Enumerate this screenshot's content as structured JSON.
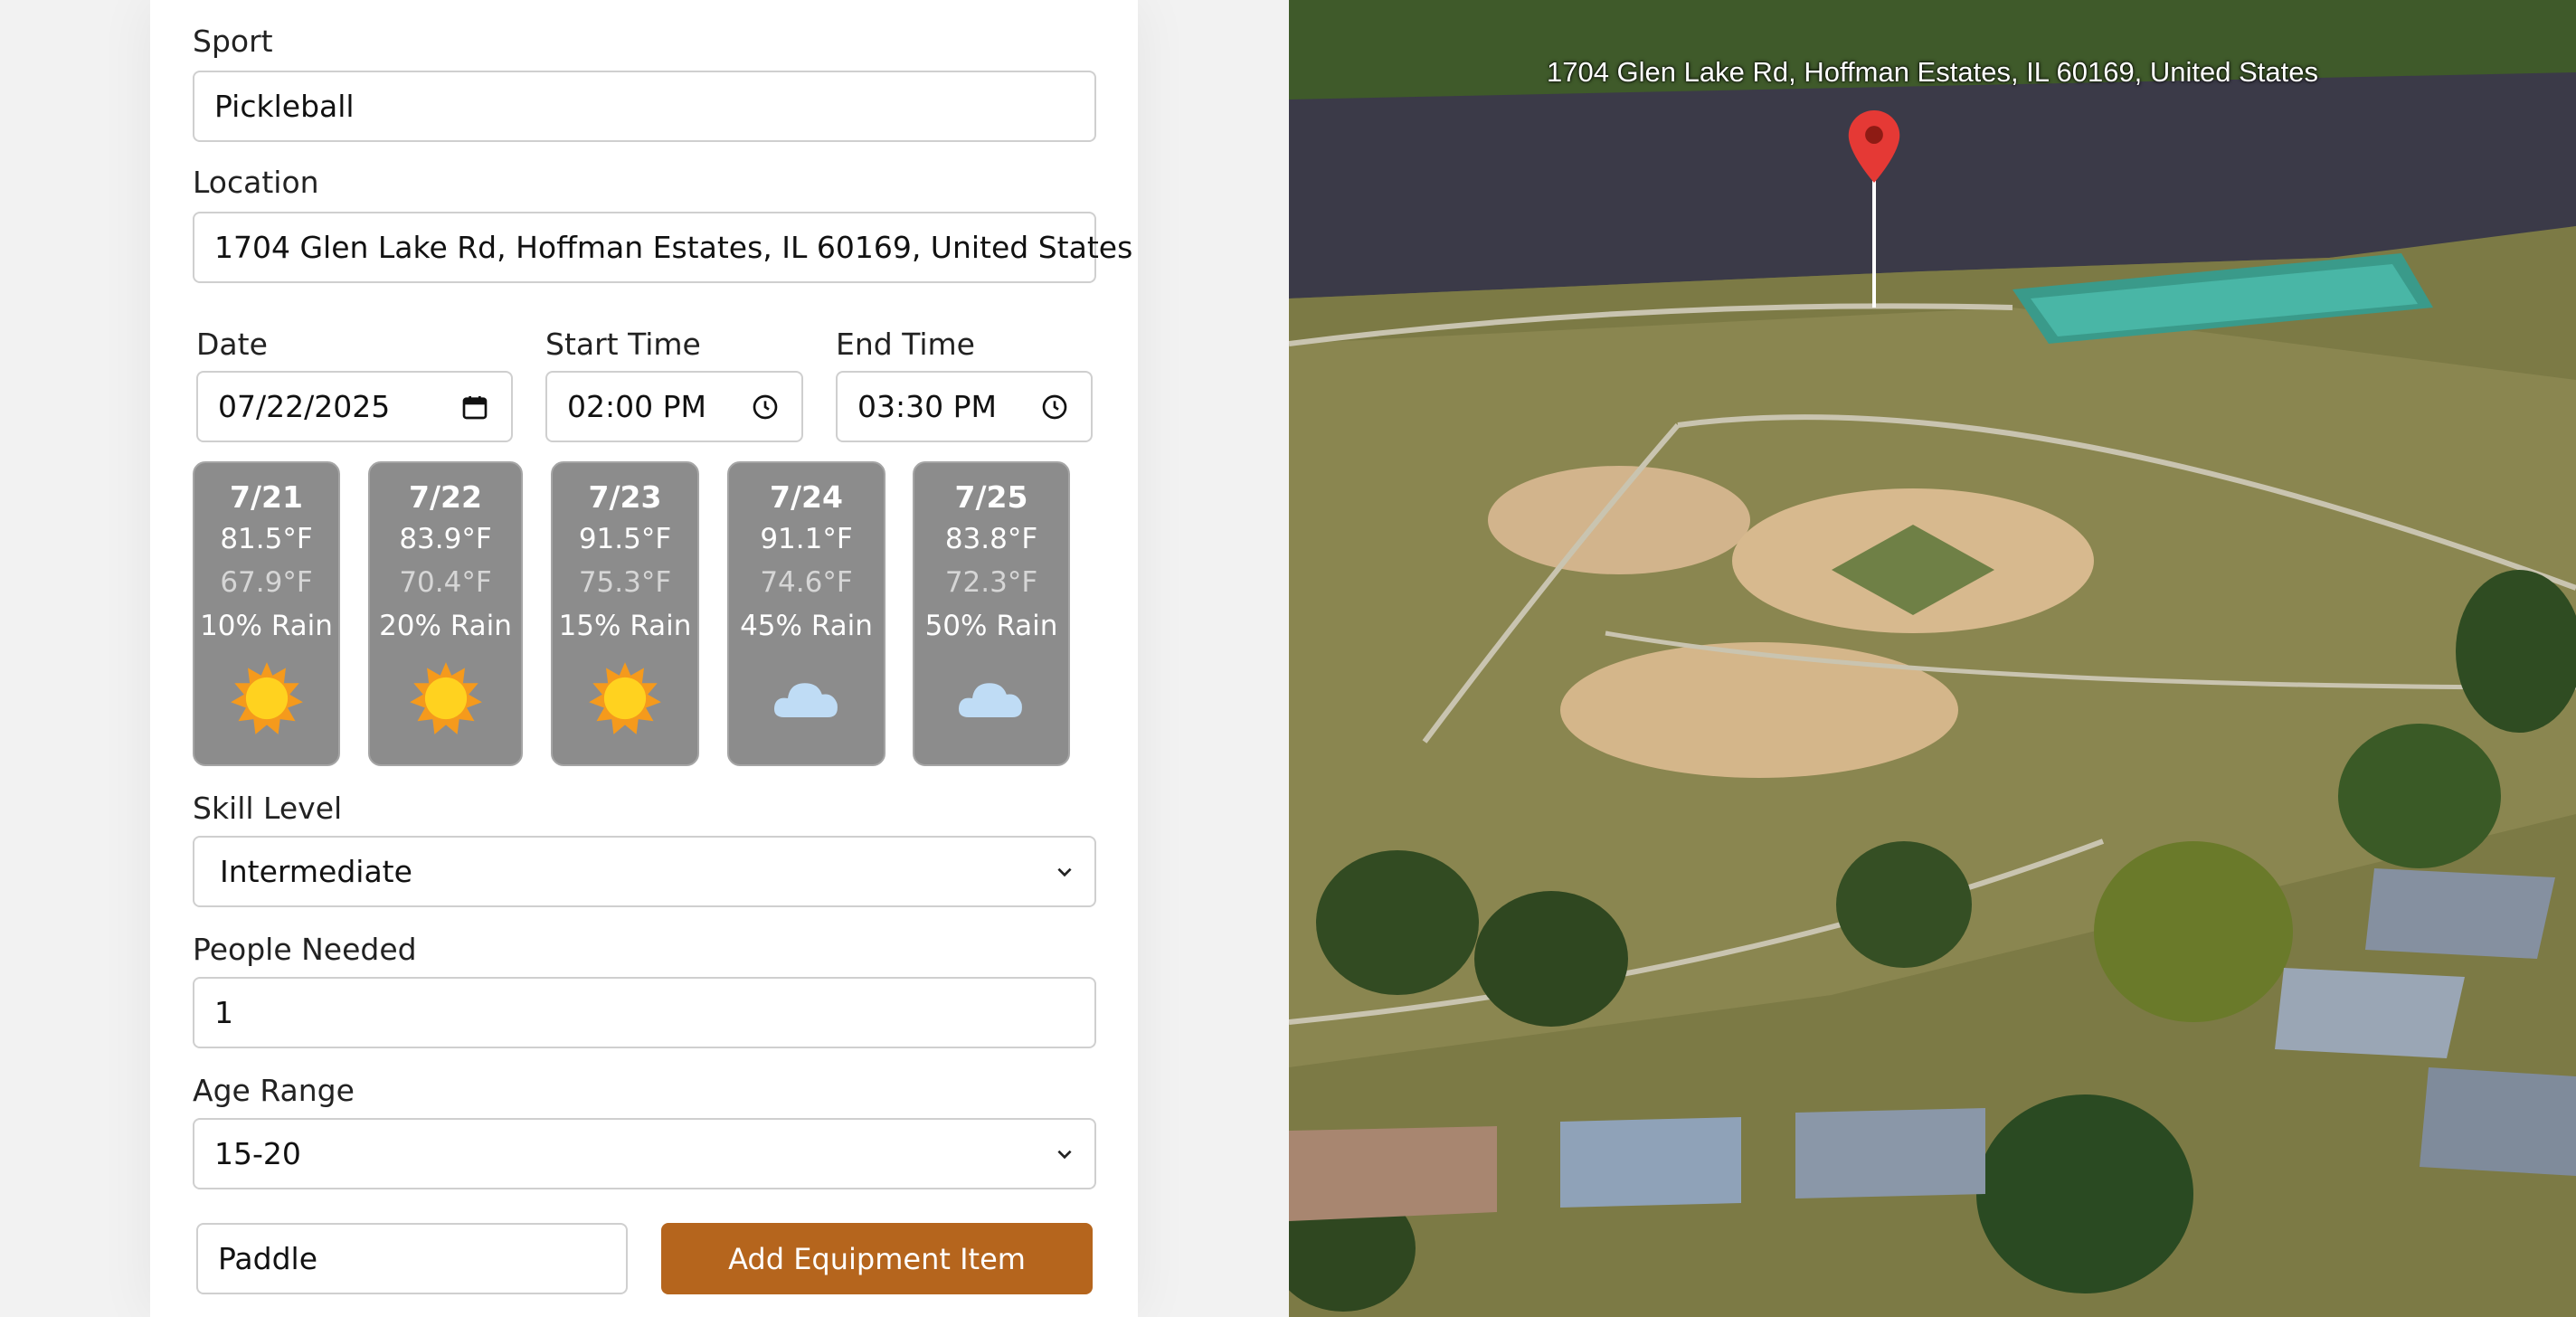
{
  "form": {
    "sport": {
      "label": "Sport",
      "value": "Pickleball"
    },
    "location": {
      "label": "Location",
      "value": "1704 Glen Lake Rd, Hoffman Estates, IL 60169, United States"
    },
    "date": {
      "label": "Date",
      "value": "07/22/2025"
    },
    "start_time": {
      "label": "Start Time",
      "value": "02:00 PM"
    },
    "end_time": {
      "label": "End Time",
      "value": "03:30 PM"
    },
    "forecast": [
      {
        "date": "7/21",
        "high": "81.5°F",
        "low": "67.9°F",
        "rain": "10% Rain",
        "icon": "sun-icon"
      },
      {
        "date": "7/22",
        "high": "83.9°F",
        "low": "70.4°F",
        "rain": "20% Rain",
        "icon": "sun-icon"
      },
      {
        "date": "7/23",
        "high": "91.5°F",
        "low": "75.3°F",
        "rain": "15% Rain",
        "icon": "sun-icon"
      },
      {
        "date": "7/24",
        "high": "91.1°F",
        "low": "74.6°F",
        "rain": "45% Rain",
        "icon": "cloud-icon"
      },
      {
        "date": "7/25",
        "high": "83.8°F",
        "low": "72.3°F",
        "rain": "50% Rain",
        "icon": "cloud-icon"
      }
    ],
    "skill_level": {
      "label": "Skill Level",
      "value": "Intermediate"
    },
    "people_needed": {
      "label": "People Needed",
      "value": "1"
    },
    "age_range": {
      "label": "Age Range",
      "value": "15-20"
    },
    "equipment": {
      "value": "Paddle",
      "button_label": "Add Equipment Item"
    }
  },
  "map": {
    "address_label": "1704 Glen Lake Rd, Hoffman Estates, IL 60169, United States",
    "marker_icon": "map-pin-icon"
  },
  "colors": {
    "accent": "#b5651d",
    "weather_card": "#8c8c8c",
    "sun": "#ffd21f",
    "cloud": "#bfdcf5",
    "pin": "#e53935"
  }
}
